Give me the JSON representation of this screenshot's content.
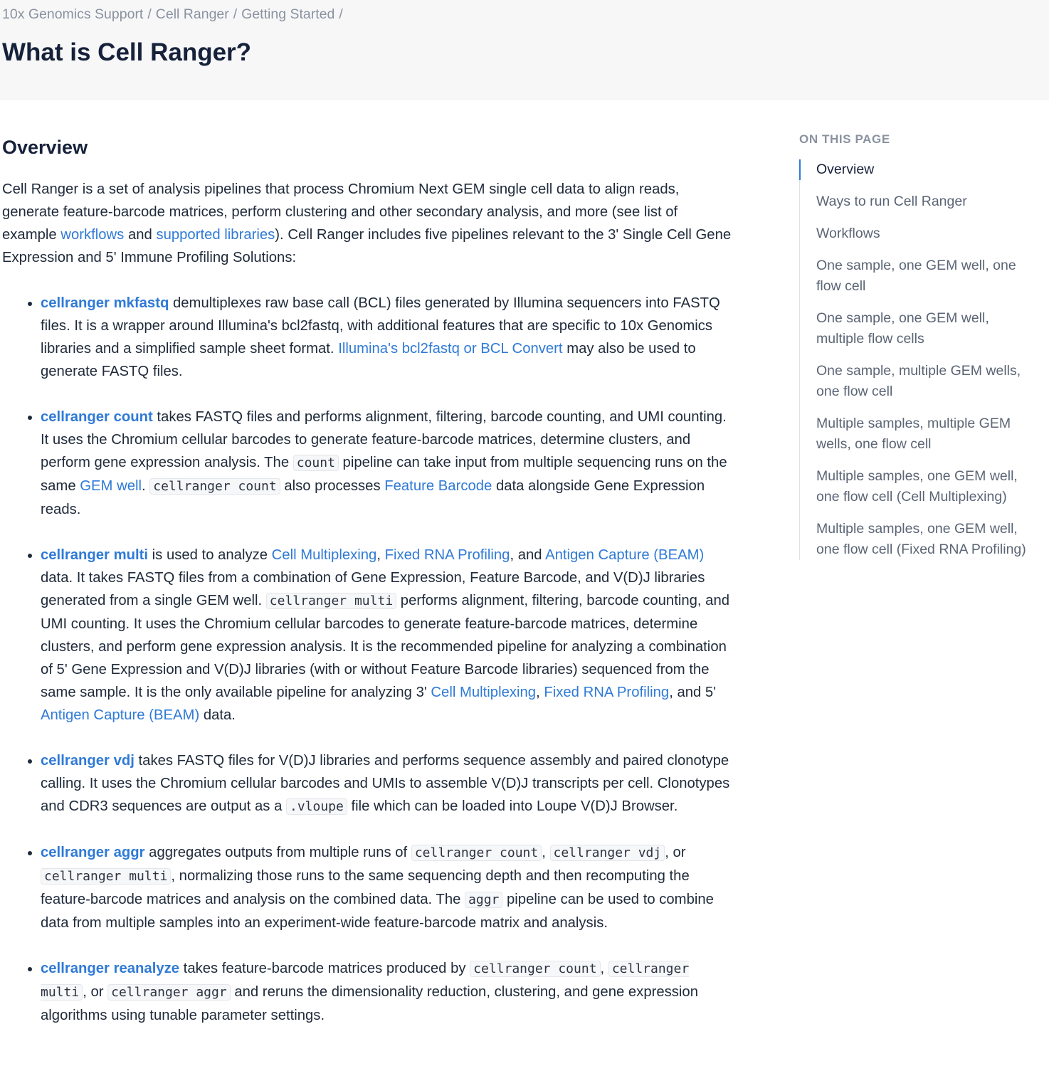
{
  "breadcrumb": {
    "items": [
      "10x Genomics Support",
      "Cell Ranger",
      "Getting Started"
    ],
    "separator": "/"
  },
  "page_title": "What is Cell Ranger?",
  "overview": {
    "heading": "Overview",
    "intro": {
      "t1": "Cell Ranger is a set of analysis pipelines that process Chromium Next GEM single cell data to align reads, generate feature-barcode matrices, perform clustering and other secondary analysis, and more (see list of example ",
      "link_workflows": "workflows",
      "t2": " and ",
      "link_supported": "supported libraries",
      "t3": "). Cell Ranger includes five pipelines relevant to the 3' Single Cell Gene Expression and 5' Immune Profiling Solutions:"
    },
    "pipelines": {
      "mkfastq": {
        "name": "cellranger mkfastq",
        "t1": " demultiplexes raw base call (BCL) files generated by Illumina sequencers into FASTQ files. It is a wrapper around Illumina's bcl2fastq, with additional features that are specific to 10x Genomics libraries and a simplified sample sheet format. ",
        "link1": "Illumina's bcl2fastq or BCL Convert",
        "t2": " may also be used to generate FASTQ files."
      },
      "count": {
        "name": "cellranger count",
        "t1": " takes FASTQ files and performs alignment, filtering, barcode counting, and UMI counting. It uses the Chromium cellular barcodes to generate feature-barcode matrices, determine clusters, and perform gene expression analysis. The ",
        "code1": "count",
        "t2": " pipeline can take input from multiple sequencing runs on the same ",
        "link1": "GEM well",
        "t3": ". ",
        "code2": "cellranger count",
        "t4": " also processes ",
        "link2": "Feature Barcode",
        "t5": " data alongside Gene Expression reads."
      },
      "multi": {
        "name": "cellranger multi",
        "t1": " is used to analyze ",
        "link1": "Cell Multiplexing",
        "t2": ", ",
        "link2": "Fixed RNA Profiling",
        "t3": ", and ",
        "link3": "Antigen Capture (BEAM)",
        "t4": " data. It takes FASTQ files from a combination of Gene Expression, Feature Barcode, and V(D)J libraries generated from a single GEM well. ",
        "code1": "cellranger multi",
        "t5": " performs alignment, filtering, barcode counting, and UMI counting. It uses the Chromium cellular barcodes to generate feature-barcode matrices, determine clusters, and perform gene expression analysis. It is the recommended pipeline for analyzing a combination of 5' Gene Expression and V(D)J libraries (with or without Feature Barcode libraries) sequenced from the same sample. It is the only available pipeline for analyzing 3' ",
        "link4": "Cell Multiplexing",
        "t6": ", ",
        "link5": "Fixed RNA Profiling",
        "t7": ", and 5' ",
        "link6": "Antigen Capture (BEAM)",
        "t8": " data."
      },
      "vdj": {
        "name": "cellranger vdj",
        "t1": " takes FASTQ files for V(D)J libraries and performs sequence assembly and paired clonotype calling. It uses the Chromium cellular barcodes and UMIs to assemble V(D)J transcripts per cell. Clonotypes and CDR3 sequences are output as a ",
        "code1": ".vloupe",
        "t2": " file which can be loaded into Loupe V(D)J Browser."
      },
      "aggr": {
        "name": "cellranger aggr",
        "t1": " aggregates outputs from multiple runs of ",
        "code1": "cellranger count",
        "t2": ", ",
        "code2": "cellranger vdj",
        "t3": ", or ",
        "code3": "cellranger multi",
        "t4": ", normalizing those runs to the same sequencing depth and then recomputing the feature-barcode matrices and analysis on the combined data. The ",
        "code4": "aggr",
        "t5": " pipeline can be used to combine data from multiple samples into an experiment-wide feature-barcode matrix and analysis."
      },
      "reanalyze": {
        "name": "cellranger reanalyze",
        "t1": " takes feature-barcode matrices produced by ",
        "code1": "cellranger count",
        "t2": ", ",
        "code2": "cellranger multi",
        "t3": ", or ",
        "code3": "cellranger aggr",
        "t4": " and reruns the dimensionality reduction, clustering, and gene expression algorithms using tunable parameter settings."
      }
    }
  },
  "toc": {
    "heading": "ON THIS PAGE",
    "items": [
      "Overview",
      "Ways to run Cell Ranger",
      "Workflows",
      "One sample, one GEM well, one flow cell",
      "One sample, one GEM well, multiple flow cells",
      "One sample, multiple GEM wells, one flow cell",
      "Multiple samples, multiple GEM wells, one flow cell",
      "Multiple samples, one GEM well, one flow cell (Cell Multiplexing)",
      "Multiple samples, one GEM well, one flow cell (Fixed RNA Profiling)"
    ],
    "active_index": 0
  }
}
